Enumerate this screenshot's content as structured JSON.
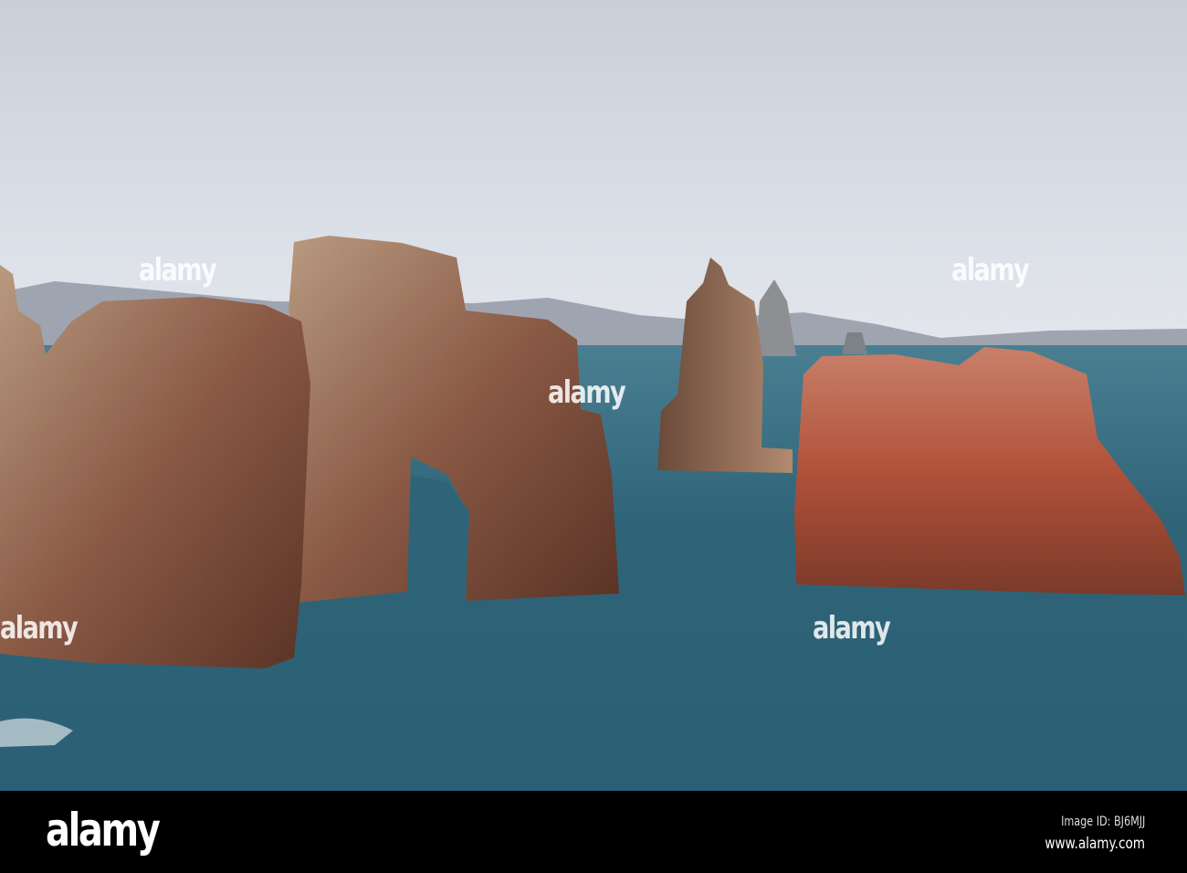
{
  "footer": {
    "logo": "alamy",
    "image_id": "Image ID: BJ6MJJ",
    "website": "www.alamy.com"
  },
  "watermark": "alamy",
  "colors": {
    "sky": "#d6dbe3",
    "sea": "#2f6478",
    "rock": "#b35a3c",
    "footer": "#000000"
  }
}
